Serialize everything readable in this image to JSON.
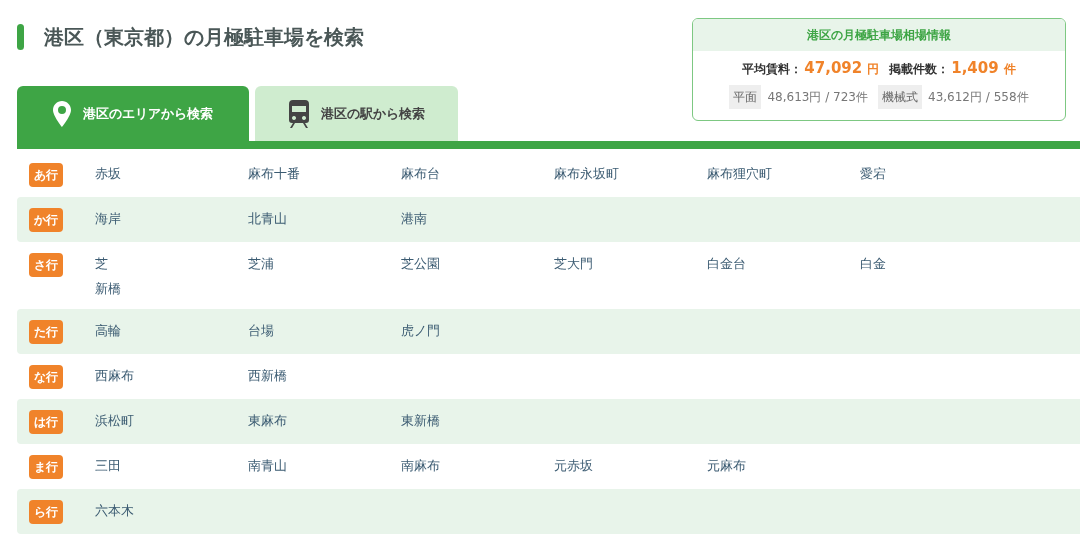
{
  "title": "港区（東京都）の月極駐車場を検索",
  "summary": {
    "title": "港区の月極駐車場相場情報",
    "avg_label": "平均賃料：",
    "avg_value": "47,092",
    "avg_unit": "円",
    "count_label": "掲載件数：",
    "count_value": "1,409",
    "count_unit": "件",
    "breakdown": [
      {
        "label": "平面",
        "value": "48,613円 / 723件"
      },
      {
        "label": "機械式",
        "value": "43,612円 / 558件"
      }
    ]
  },
  "tabs": [
    {
      "label": "港区のエリアから検索",
      "selected": true,
      "kind": "pin"
    },
    {
      "label": "港区の駅から検索",
      "selected": false,
      "kind": "train"
    }
  ],
  "rows": [
    {
      "label": "あ行",
      "areas": [
        "赤坂",
        "麻布十番",
        "麻布台",
        "麻布永坂町",
        "麻布狸穴町",
        "愛宕"
      ]
    },
    {
      "label": "か行",
      "areas": [
        "海岸",
        "北青山",
        "港南"
      ]
    },
    {
      "label": "さ行",
      "areas": [
        "芝",
        "芝浦",
        "芝公園",
        "芝大門",
        "白金台",
        "白金",
        "新橋"
      ]
    },
    {
      "label": "た行",
      "areas": [
        "高輪",
        "台場",
        "虎ノ門"
      ]
    },
    {
      "label": "な行",
      "areas": [
        "西麻布",
        "西新橋"
      ]
    },
    {
      "label": "は行",
      "areas": [
        "浜松町",
        "東麻布",
        "東新橋"
      ]
    },
    {
      "label": "ま行",
      "areas": [
        "三田",
        "南青山",
        "南麻布",
        "元赤坂",
        "元麻布"
      ]
    },
    {
      "label": "ら行",
      "areas": [
        "六本木"
      ]
    }
  ]
}
